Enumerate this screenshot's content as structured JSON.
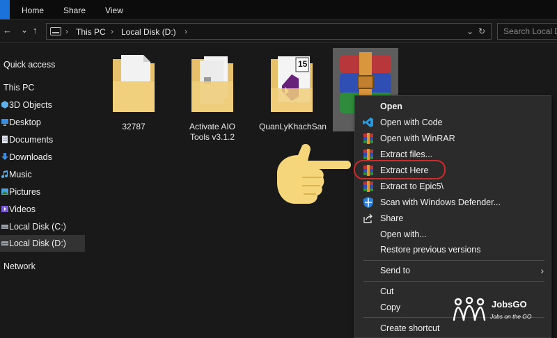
{
  "ribbon": {
    "tabs": [
      "Home",
      "Share",
      "View"
    ]
  },
  "addressbar": {
    "back": "←",
    "forward": "→",
    "recent": "⌄",
    "up": "↑",
    "crumbs": [
      "This PC",
      "Local Disk (D:)"
    ],
    "dropdown": "⌄",
    "refresh": "↻",
    "search_placeholder": "Search Local Disk (D:)"
  },
  "sidebar": {
    "items": [
      {
        "label": "Quick access",
        "top_level": true
      },
      {
        "label": "This PC",
        "top_level": true
      },
      {
        "label": "3D Objects",
        "icon": "3d-objects-icon"
      },
      {
        "label": "Desktop",
        "icon": "desktop-icon"
      },
      {
        "label": "Documents",
        "icon": "documents-icon"
      },
      {
        "label": "Downloads",
        "icon": "downloads-icon"
      },
      {
        "label": "Music",
        "icon": "music-icon"
      },
      {
        "label": "Pictures",
        "icon": "pictures-icon"
      },
      {
        "label": "Videos",
        "icon": "videos-icon"
      },
      {
        "label": "Local Disk (C:)",
        "icon": "drive-icon"
      },
      {
        "label": "Local Disk (D:)",
        "icon": "drive-icon",
        "selected": true
      },
      {
        "label": "Network",
        "top_level": true
      }
    ]
  },
  "files": [
    {
      "name": "32787",
      "type": "folder"
    },
    {
      "name": "Activate AIO Tools v3.1.2",
      "type": "folder"
    },
    {
      "name": "QuanLyKhachSan",
      "type": "folder",
      "badge": "15"
    },
    {
      "name": "",
      "type": "winrar-archive",
      "selected": true
    }
  ],
  "context_menu": {
    "items": [
      {
        "label": "Open",
        "bold": true,
        "icon": ""
      },
      {
        "label": "Open with Code",
        "icon": "vscode-icon"
      },
      {
        "label": "Open with WinRAR",
        "icon": "winrar-icon"
      },
      {
        "label": "Extract files...",
        "icon": "winrar-icon"
      },
      {
        "label": "Extract Here",
        "icon": "winrar-icon",
        "highlighted": true
      },
      {
        "label": "Extract to Epic5\\",
        "icon": "winrar-icon"
      },
      {
        "label": "Scan with Windows Defender...",
        "icon": "defender-icon"
      },
      {
        "label": "Share",
        "icon": "share-icon"
      },
      {
        "label": "Open with...",
        "icon": ""
      },
      {
        "label": "Restore previous versions",
        "icon": ""
      },
      {
        "label": "Send to",
        "icon": "",
        "submenu": true
      },
      {
        "label": "Cut",
        "icon": ""
      },
      {
        "label": "Copy",
        "icon": ""
      },
      {
        "label": "Create shortcut",
        "icon": ""
      }
    ]
  },
  "watermark": {
    "brand": "JobsGO",
    "tagline": "Jobs on the GO"
  },
  "colors": {
    "highlight_ring": "#d62828",
    "pointer_hand": "#f5d67a",
    "accent": "#1a73d9"
  }
}
